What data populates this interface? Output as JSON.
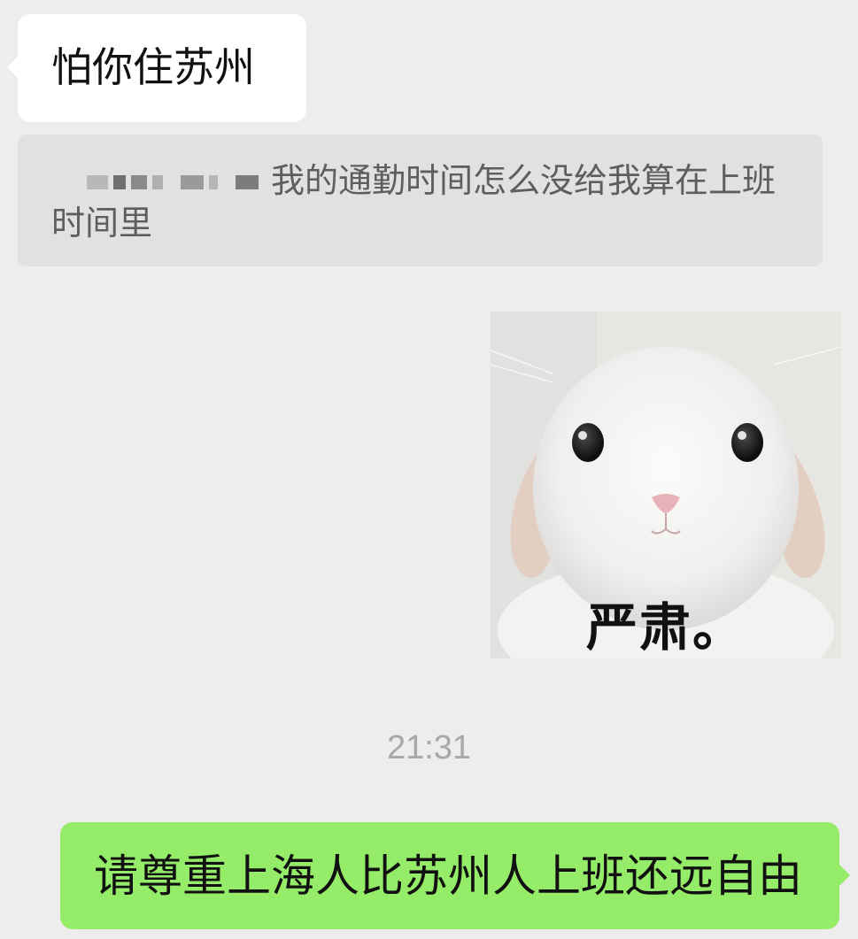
{
  "messages": [
    {
      "direction": "incoming",
      "text": "怕你住苏州"
    },
    {
      "direction": "incoming",
      "quote_text": "我的通勤时间怎么没给我算在上班时间里",
      "sender_redacted": true
    },
    {
      "direction": "outgoing",
      "sticker_caption": "严肃。",
      "sticker_subject": "white-rabbit"
    }
  ],
  "timestamp": "21:31",
  "outgoing_message": {
    "text": "请尊重上海人比苏州人上班还远自由"
  },
  "colors": {
    "background": "#ededed",
    "incoming_bubble": "#ffffff",
    "quote_block": "#e1e1e1",
    "outgoing_bubble": "#95ec69",
    "timestamp": "#a8a8a8"
  }
}
